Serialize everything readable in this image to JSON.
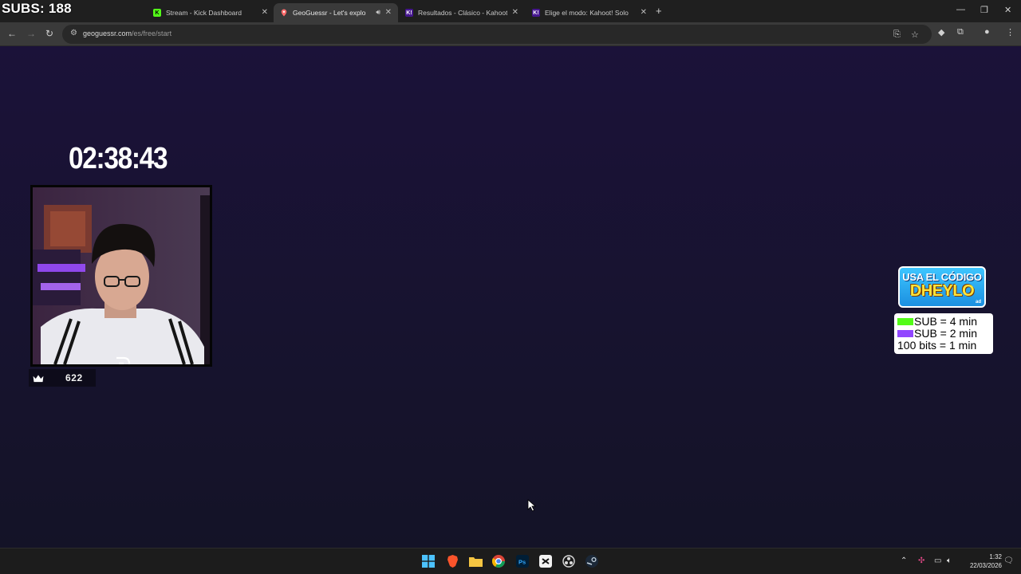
{
  "overlay": {
    "subs_text": "SUBS: 188"
  },
  "tabs": [
    {
      "label": "Stream - Kick Dashboard",
      "icon": "kick-icon",
      "active": false
    },
    {
      "label": "GeoGuessr - Let's explore t",
      "icon": "geoguessr-icon",
      "active": true
    },
    {
      "label": "Resultados - Clásico - Kahoot!",
      "icon": "kahoot-icon",
      "active": false
    },
    {
      "label": "Elige el modo: Kahoot! Solo",
      "icon": "kahoot-icon",
      "active": false
    }
  ],
  "address_bar": {
    "url_host": "geoguessr.com",
    "url_path": "/es/free/start"
  },
  "stream": {
    "timer": "02:38:43",
    "viewer_count": "622",
    "promo_line1": "USA EL CÓDIGO",
    "promo_line2": "DHEYLO",
    "promo_tag": "ad",
    "rules": [
      {
        "icon": "kick-sub-icon",
        "text": "SUB = 4 min",
        "color": "#53fc18"
      },
      {
        "icon": "twitch-sub-icon",
        "text": "SUB = 2 min",
        "color": "#9146ff"
      },
      {
        "icon": "",
        "text": "100 bits = 1 min",
        "color": ""
      }
    ]
  },
  "taskbar": {
    "apps": [
      "windows-start-icon",
      "brave-icon",
      "file-explorer-icon",
      "chrome-icon",
      "photoshop-icon",
      "capcut-icon",
      "obs-icon",
      "steam-icon"
    ],
    "clock_time": "1:32",
    "clock_date": "22/03/2026"
  },
  "colors": {
    "page_bg": "#1b1239",
    "browser_chrome": "#3a3a3a",
    "promo_bg": "#1b8fe0"
  }
}
